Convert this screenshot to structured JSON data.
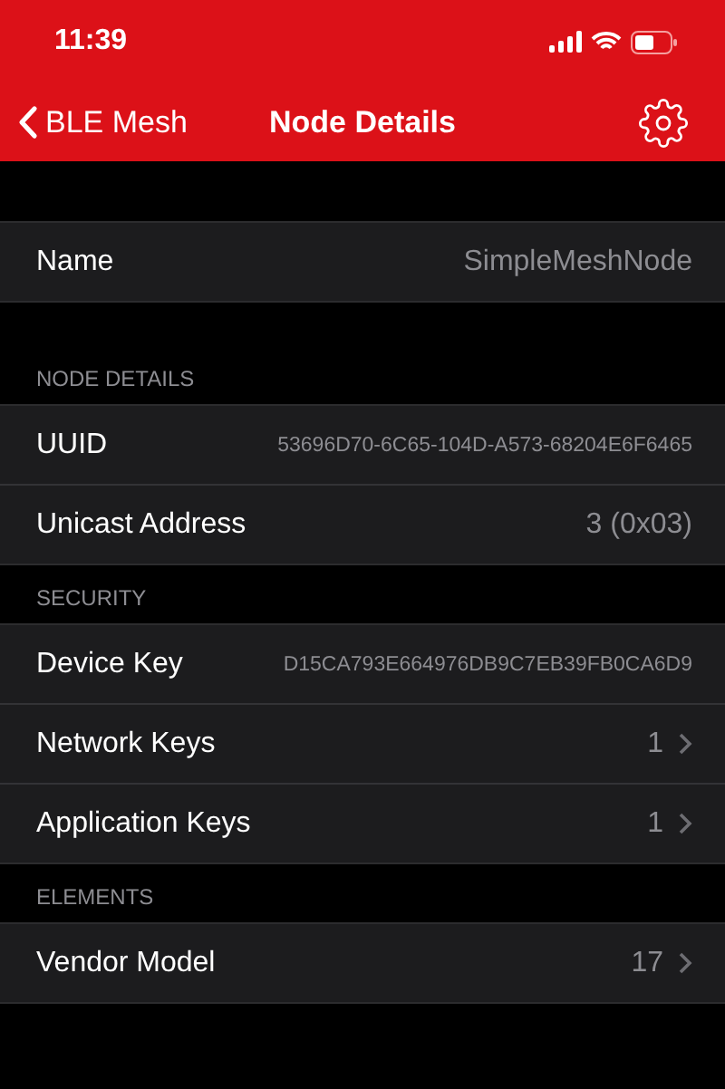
{
  "status_bar": {
    "time": "11:39"
  },
  "nav_bar": {
    "back_label": "BLE Mesh",
    "title": "Node Details"
  },
  "sections": [
    {
      "rows": [
        {
          "kind": "plain",
          "label": "Name",
          "value": "SimpleMeshNode"
        }
      ]
    },
    {
      "header": "NODE DETAILS",
      "rows": [
        {
          "kind": "code",
          "label": "UUID",
          "value": "53696D70-6C65-104D-A573-68204E6F6465"
        },
        {
          "kind": "plain",
          "label": "Unicast Address",
          "value": "3 (0x03)"
        }
      ]
    },
    {
      "header": "SECURITY",
      "rows": [
        {
          "kind": "code",
          "label": "Device Key",
          "value": "D15CA793E664976DB9C7EB39FB0CA6D9"
        },
        {
          "kind": "link",
          "label": "Network Keys",
          "value": "1"
        },
        {
          "kind": "link",
          "label": "Application Keys",
          "value": "1"
        }
      ]
    },
    {
      "header": "ELEMENTS",
      "rows": [
        {
          "kind": "link",
          "label": "Vendor Model",
          "value": "17"
        }
      ]
    }
  ]
}
